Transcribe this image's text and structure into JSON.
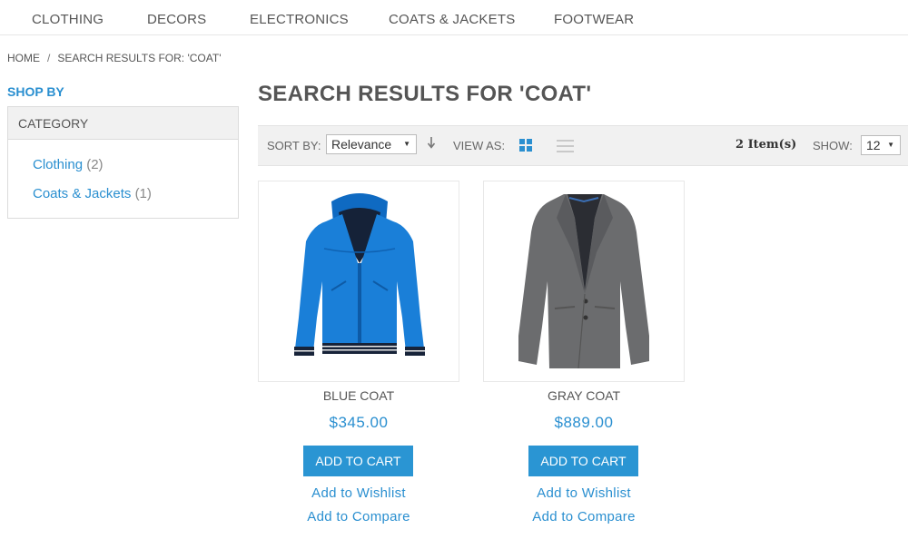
{
  "nav": {
    "items": [
      "CLOTHING",
      "DECORS",
      "ELECTRONICS",
      "COATS & JACKETS",
      "FOOTWEAR"
    ]
  },
  "breadcrumb": {
    "home": "HOME",
    "separator": "/",
    "current": "SEARCH RESULTS FOR: 'COAT'"
  },
  "sidebar": {
    "shop_by": "SHOP BY",
    "category_title": "CATEGORY",
    "categories": [
      {
        "label": "Clothing",
        "count": "(2)"
      },
      {
        "label": "Coats & Jackets",
        "count": "(1)"
      }
    ]
  },
  "main": {
    "title": "SEARCH RESULTS FOR 'COAT'"
  },
  "toolbar": {
    "sort_label": "SORT BY:",
    "sort_value": "Relevance",
    "sort_direction_icon": "arrow-down-icon",
    "view_label": "VIEW AS:",
    "view_grid_icon": "grid-view-icon",
    "view_list_icon": "list-view-icon",
    "item_count": "2 Item(s)",
    "show_label": "SHOW:",
    "show_value": "12",
    "caret": "▼"
  },
  "products": [
    {
      "name": "BLUE COAT",
      "price": "$345.00",
      "add_to_cart": "ADD TO CART",
      "wishlist": "Add to Wishlist",
      "compare": "Add to Compare",
      "image_icon": "blue-jacket-image",
      "color": "#1a7fd8"
    },
    {
      "name": "GRAY COAT",
      "price": "$889.00",
      "add_to_cart": "ADD TO CART",
      "wishlist": "Add to Wishlist",
      "compare": "Add to Compare",
      "image_icon": "gray-blazer-image",
      "color": "#6b6c6e"
    }
  ],
  "colors": {
    "accent": "#2a8fd0",
    "button": "#2a95d3",
    "toolbar_bg": "#f1f1f1"
  }
}
